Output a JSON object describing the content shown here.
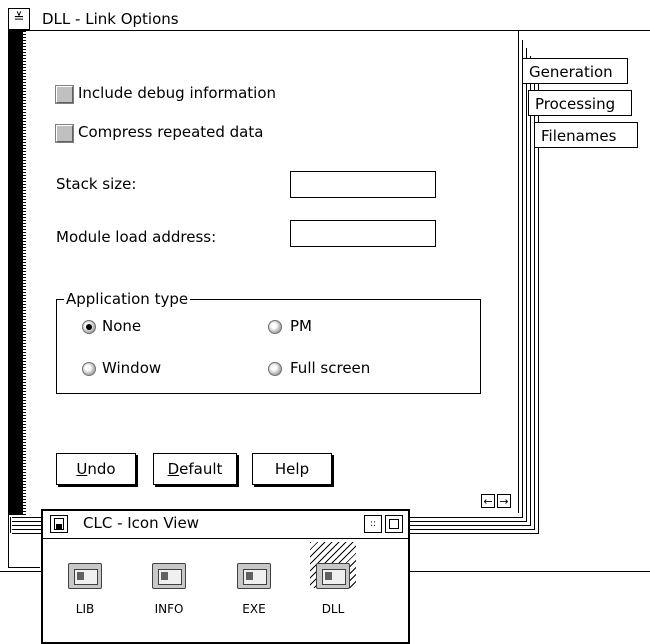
{
  "window": {
    "title": "DLL - Link Options",
    "sysmenu_glyph": "≚"
  },
  "tabs": [
    {
      "label": "Generation",
      "selected": true
    },
    {
      "label": "Processing",
      "selected": false
    },
    {
      "label": "Filenames",
      "selected": false
    }
  ],
  "options": {
    "debug_label": "Include debug information",
    "debug_checked": false,
    "compress_label": "Compress repeated data",
    "compress_checked": false
  },
  "fields": {
    "stack_label": "Stack size:",
    "stack_value": "",
    "module_label": "Module load address:",
    "module_value": ""
  },
  "app_type": {
    "title": "Application type",
    "options": [
      {
        "label": "None",
        "selected": true
      },
      {
        "label": "PM",
        "selected": false
      },
      {
        "label": "Window",
        "selected": false
      },
      {
        "label": "Full screen",
        "selected": false
      }
    ]
  },
  "buttons": {
    "undo_mnemonic": "U",
    "undo_rest": "ndo",
    "default_mnemonic": "D",
    "default_rest": "efault",
    "help": "Help"
  },
  "page_nav": {
    "prev": "←",
    "next": "→"
  },
  "icon_view": {
    "title": "CLC - Icon View",
    "min_glyph": "::",
    "items": [
      {
        "label": "LIB",
        "selected": false
      },
      {
        "label": "INFO",
        "selected": false
      },
      {
        "label": "EXE",
        "selected": false
      },
      {
        "label": "DLL",
        "selected": true
      }
    ]
  }
}
